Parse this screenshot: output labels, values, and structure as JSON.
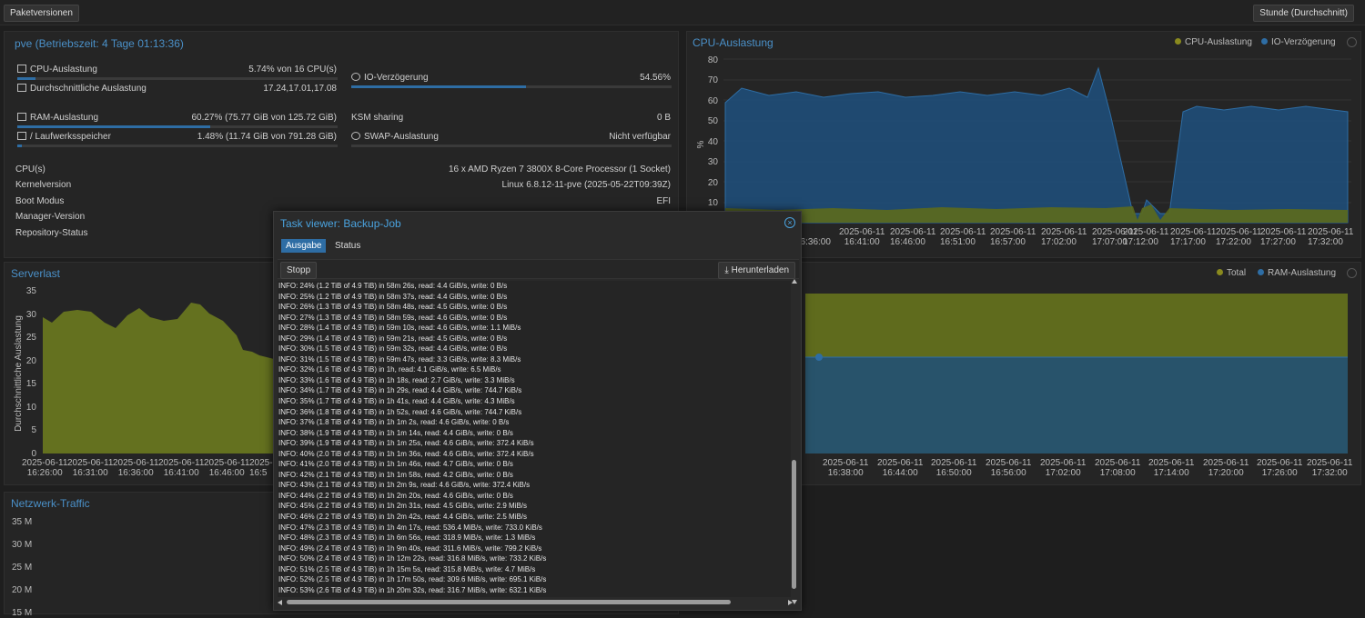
{
  "topbar": {
    "left_button": "Paketversionen",
    "right_button": "Stunde (Durchschnitt)"
  },
  "summary": {
    "title": "pve (Betriebszeit: 4 Tage 01:13:36)",
    "cpu": {
      "label": "CPU-Auslastung",
      "value": "5.74% von 16 CPU(s)",
      "fill": 0.0574
    },
    "load": {
      "label": "Durchschnittliche Auslastung",
      "value": "17.24,17.01,17.08"
    },
    "io": {
      "label": "IO-Verzögerung",
      "value": "54.56%",
      "fill": 0.5456
    },
    "ram": {
      "label": "RAM-Auslastung",
      "value": "60.27% (75.77 GiB von 125.72 GiB)",
      "fill": 0.6027
    },
    "ksm": {
      "label": "KSM sharing",
      "value": "0 B"
    },
    "disk": {
      "label": "/ Laufwerksspeicher",
      "value": "1.48% (11.74 GiB von 791.28 GiB)",
      "fill": 0.0148
    },
    "swap": {
      "label": "SWAP-Auslastung",
      "value": "Nicht verfügbar"
    },
    "info": [
      {
        "label": "CPU(s)",
        "value": "16 x AMD Ryzen 7 3800X 8-Core Processor (1 Socket)"
      },
      {
        "label": "Kernelversion",
        "value": "Linux 6.8.12-11-pve (2025-05-22T09:39Z)"
      },
      {
        "label": "Boot Modus",
        "value": "EFI"
      },
      {
        "label": "Manager-Version",
        "value": ""
      },
      {
        "label": "Repository-Status",
        "value": ""
      }
    ]
  },
  "cpu_chart": {
    "title": "CPU-Auslastung",
    "legend": [
      "CPU-Auslastung",
      "IO-Verzögerung"
    ],
    "ylabel": "%",
    "yticks": [
      "80",
      "70",
      "60",
      "50",
      "40",
      "30",
      "20",
      "10"
    ],
    "xdates": [
      "2025-06-11",
      "2025-06-11",
      "2025-06-11",
      "2025-06-11",
      "2025-06-11",
      "2025-06-11",
      "2025-06-11",
      "2025-06-11",
      "2025-06-11",
      "2025-06-11",
      "2025-06-11",
      "2025-06-11"
    ],
    "xtimes": [
      "16:36:00",
      "16:41:00",
      "16:46:00",
      "16:51:00",
      "16:57:00",
      "17:02:00",
      "17:07:00",
      "17:12:00",
      "17:17:00",
      "17:22:00",
      "17:27:00",
      "17:32:00"
    ]
  },
  "load_chart": {
    "title": "Serverlast",
    "ylabel": "Durchschnittliche Auslastung",
    "yticks": [
      "35",
      "30",
      "25",
      "20",
      "15",
      "10",
      "5",
      "0"
    ],
    "xdates": [
      "2025-06-11",
      "2025-06-11",
      "2025-06-11",
      "2025-06-11",
      "2025-06-11",
      "2025-06-11"
    ],
    "xtimes": [
      "16:26:00",
      "16:31:00",
      "16:36:00",
      "16:41:00",
      "16:46:00",
      "16:5"
    ]
  },
  "ram_chart": {
    "legend": [
      "Total",
      "RAM-Auslastung"
    ],
    "xdates": [
      "2025-06-11",
      "2025-06-11",
      "2025-06-11",
      "2025-06-11",
      "2025-06-11",
      "2025-06-11",
      "2025-06-11",
      "2025-06-11",
      "2025-06-11",
      "2025-06-11"
    ],
    "xtimes": [
      "16:38:00",
      "16:44:00",
      "16:50:00",
      "16:56:00",
      "17:02:00",
      "17:08:00",
      "17:14:00",
      "17:20:00",
      "17:26:00",
      "17:32:00"
    ]
  },
  "net_chart": {
    "title": "Netzwerk-Traffic",
    "yticks": [
      "35 M",
      "30 M",
      "25 M",
      "20 M",
      "15 M"
    ]
  },
  "chart_data": [
    {
      "type": "area",
      "title": "CPU-Auslastung",
      "ylabel": "%",
      "ylim": [
        0,
        80
      ],
      "x": [
        "16:36:00",
        "16:41:00",
        "16:46:00",
        "16:51:00",
        "16:57:00",
        "17:02:00",
        "17:07:00",
        "17:12:00",
        "17:17:00",
        "17:22:00",
        "17:27:00",
        "17:32:00"
      ],
      "series": [
        {
          "name": "CPU-Auslastung",
          "values": [
            6,
            6,
            5,
            5,
            6,
            5,
            6,
            4,
            6,
            5,
            6,
            5
          ]
        },
        {
          "name": "IO-Verzögerung",
          "values": [
            57,
            58,
            58,
            56,
            60,
            58,
            68,
            0,
            54,
            56,
            56,
            54
          ]
        }
      ]
    },
    {
      "type": "area",
      "title": "Serverlast",
      "ylabel": "Durchschnittliche Auslastung",
      "ylim": [
        0,
        35
      ],
      "x": [
        "16:26:00",
        "16:31:00",
        "16:36:00",
        "16:41:00",
        "16:46:00",
        "16:5"
      ],
      "series": [
        {
          "values": [
            30,
            31,
            28,
            32,
            26,
            21
          ]
        }
      ]
    },
    {
      "type": "area",
      "x": [
        "16:38:00",
        "16:44:00",
        "16:50:00",
        "16:56:00",
        "17:02:00",
        "17:08:00",
        "17:14:00",
        "17:20:00",
        "17:26:00",
        "17:32:00"
      ],
      "series": [
        {
          "name": "Total",
          "values": [
            125.72,
            125.72,
            125.72,
            125.72,
            125.72,
            125.72,
            125.72,
            125.72,
            125.72,
            125.72
          ]
        },
        {
          "name": "RAM-Auslastung",
          "values": [
            75.77,
            75.77,
            75.77,
            75.77,
            75.77,
            75.77,
            75.77,
            75.77,
            75.77,
            75.77
          ]
        }
      ]
    }
  ],
  "task_viewer": {
    "title": "Task viewer: Backup-Job",
    "tabs": [
      "Ausgabe",
      "Status"
    ],
    "stop_label": "Stopp",
    "download_label": "Herunterladen",
    "log": [
      "INFO:  24% (1.2 TiB of 4.9 TiB) in 58m 26s, read: 4.4 GiB/s, write: 0 B/s",
      "INFO:  25% (1.2 TiB of 4.9 TiB) in 58m 37s, read: 4.4 GiB/s, write: 0 B/s",
      "INFO:  26% (1.3 TiB of 4.9 TiB) in 58m 48s, read: 4.5 GiB/s, write: 0 B/s",
      "INFO:  27% (1.3 TiB of 4.9 TiB) in 58m 59s, read: 4.6 GiB/s, write: 0 B/s",
      "INFO:  28% (1.4 TiB of 4.9 TiB) in 59m 10s, read: 4.6 GiB/s, write: 1.1 MiB/s",
      "INFO:  29% (1.4 TiB of 4.9 TiB) in 59m 21s, read: 4.5 GiB/s, write: 0 B/s",
      "INFO:  30% (1.5 TiB of 4.9 TiB) in 59m 32s, read: 4.4 GiB/s, write: 0 B/s",
      "INFO:  31% (1.5 TiB of 4.9 TiB) in 59m 47s, read: 3.3 GiB/s, write: 8.3 MiB/s",
      "INFO:  32% (1.6 TiB of 4.9 TiB) in 1h, read: 4.1 GiB/s, write: 6.5 MiB/s",
      "INFO:  33% (1.6 TiB of 4.9 TiB) in 1h 18s, read: 2.7 GiB/s, write: 3.3 MiB/s",
      "INFO:  34% (1.7 TiB of 4.9 TiB) in 1h 29s, read: 4.4 GiB/s, write: 744.7 KiB/s",
      "INFO:  35% (1.7 TiB of 4.9 TiB) in 1h 41s, read: 4.4 GiB/s, write: 4.3 MiB/s",
      "INFO:  36% (1.8 TiB of 4.9 TiB) in 1h 52s, read: 4.6 GiB/s, write: 744.7 KiB/s",
      "INFO:  37% (1.8 TiB of 4.9 TiB) in 1h 1m 2s, read: 4.6 GiB/s, write: 0 B/s",
      "INFO:  38% (1.9 TiB of 4.9 TiB) in 1h 1m 14s, read: 4.4 GiB/s, write: 0 B/s",
      "INFO:  39% (1.9 TiB of 4.9 TiB) in 1h 1m 25s, read: 4.6 GiB/s, write: 372.4 KiB/s",
      "INFO:  40% (2.0 TiB of 4.9 TiB) in 1h 1m 36s, read: 4.6 GiB/s, write: 372.4 KiB/s",
      "INFO:  41% (2.0 TiB of 4.9 TiB) in 1h 1m 46s, read: 4.7 GiB/s, write: 0 B/s",
      "INFO:  42% (2.1 TiB of 4.9 TiB) in 1h 1m 58s, read: 4.2 GiB/s, write: 0 B/s",
      "INFO:  43% (2.1 TiB of 4.9 TiB) in 1h 2m 9s, read: 4.6 GiB/s, write: 372.4 KiB/s",
      "INFO:  44% (2.2 TiB of 4.9 TiB) in 1h 2m 20s, read: 4.6 GiB/s, write: 0 B/s",
      "INFO:  45% (2.2 TiB of 4.9 TiB) in 1h 2m 31s, read: 4.5 GiB/s, write: 2.9 MiB/s",
      "INFO:  46% (2.2 TiB of 4.9 TiB) in 1h 2m 42s, read: 4.4 GiB/s, write: 2.5 MiB/s",
      "INFO:  47% (2.3 TiB of 4.9 TiB) in 1h 4m 17s, read: 536.4 MiB/s, write: 733.0 KiB/s",
      "INFO:  48% (2.3 TiB of 4.9 TiB) in 1h 6m 56s, read: 318.9 MiB/s, write: 1.3 MiB/s",
      "INFO:  49% (2.4 TiB of 4.9 TiB) in 1h 9m 40s, read: 311.6 MiB/s, write: 799.2 KiB/s",
      "INFO:  50% (2.4 TiB of 4.9 TiB) in 1h 12m 22s, read: 316.8 MiB/s, write: 733.2 KiB/s",
      "INFO:  51% (2.5 TiB of 4.9 TiB) in 1h 15m 5s, read: 315.8 MiB/s, write: 4.7 MiB/s",
      "INFO:  52% (2.5 TiB of 4.9 TiB) in 1h 17m 50s, read: 309.6 MiB/s, write: 695.1 KiB/s",
      "INFO:  53% (2.6 TiB of 4.9 TiB) in 1h 20m 32s, read: 316.7 MiB/s, write: 632.1 KiB/s"
    ]
  },
  "colors": {
    "accent": "#2e6da4",
    "title": "#4a90c8",
    "cpu_area": "#1f4e79",
    "load_area": "#6b7a1f",
    "total_area": "#5f6b1d",
    "ram_area": "#28536b"
  }
}
